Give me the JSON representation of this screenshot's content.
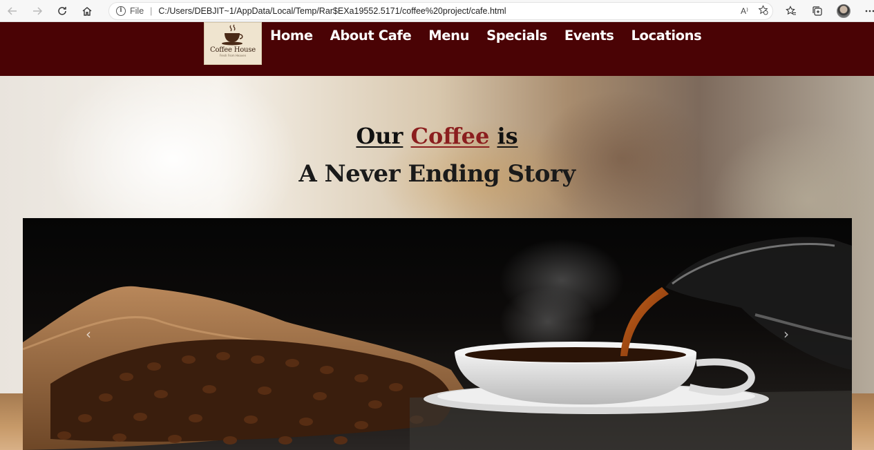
{
  "browser": {
    "file_label": "File",
    "separator": "|",
    "url": "C:/Users/DEBJIT~1/AppData/Local/Temp/Rar$EXa19552.5171/coffee%20project/cafe.html",
    "read_aloud": "A⁾",
    "icons": [
      "back-icon",
      "forward-icon",
      "refresh-icon",
      "home-icon",
      "info-icon",
      "read-aloud-icon",
      "add-favorite-icon",
      "favorites-icon",
      "collections-icon",
      "profile-avatar",
      "more-icon"
    ]
  },
  "site": {
    "logo": {
      "name": "Coffee House",
      "tagline": "Fresh From Heaven"
    },
    "nav": [
      "Home",
      "About Cafe",
      "Menu",
      "Specials",
      "Events",
      "Locations"
    ]
  },
  "hero": {
    "headline_prefix": "Our",
    "headline_highlight": "Coffee",
    "headline_suffix": "is",
    "subheadline": "A Never Ending Story"
  },
  "carousel": {
    "prev_glyph": "‹",
    "next_glyph": "›"
  },
  "colors": {
    "header_bg": "#4a0305",
    "coffee_accent": "#8b1e1e",
    "nav_text": "#ffffff"
  }
}
